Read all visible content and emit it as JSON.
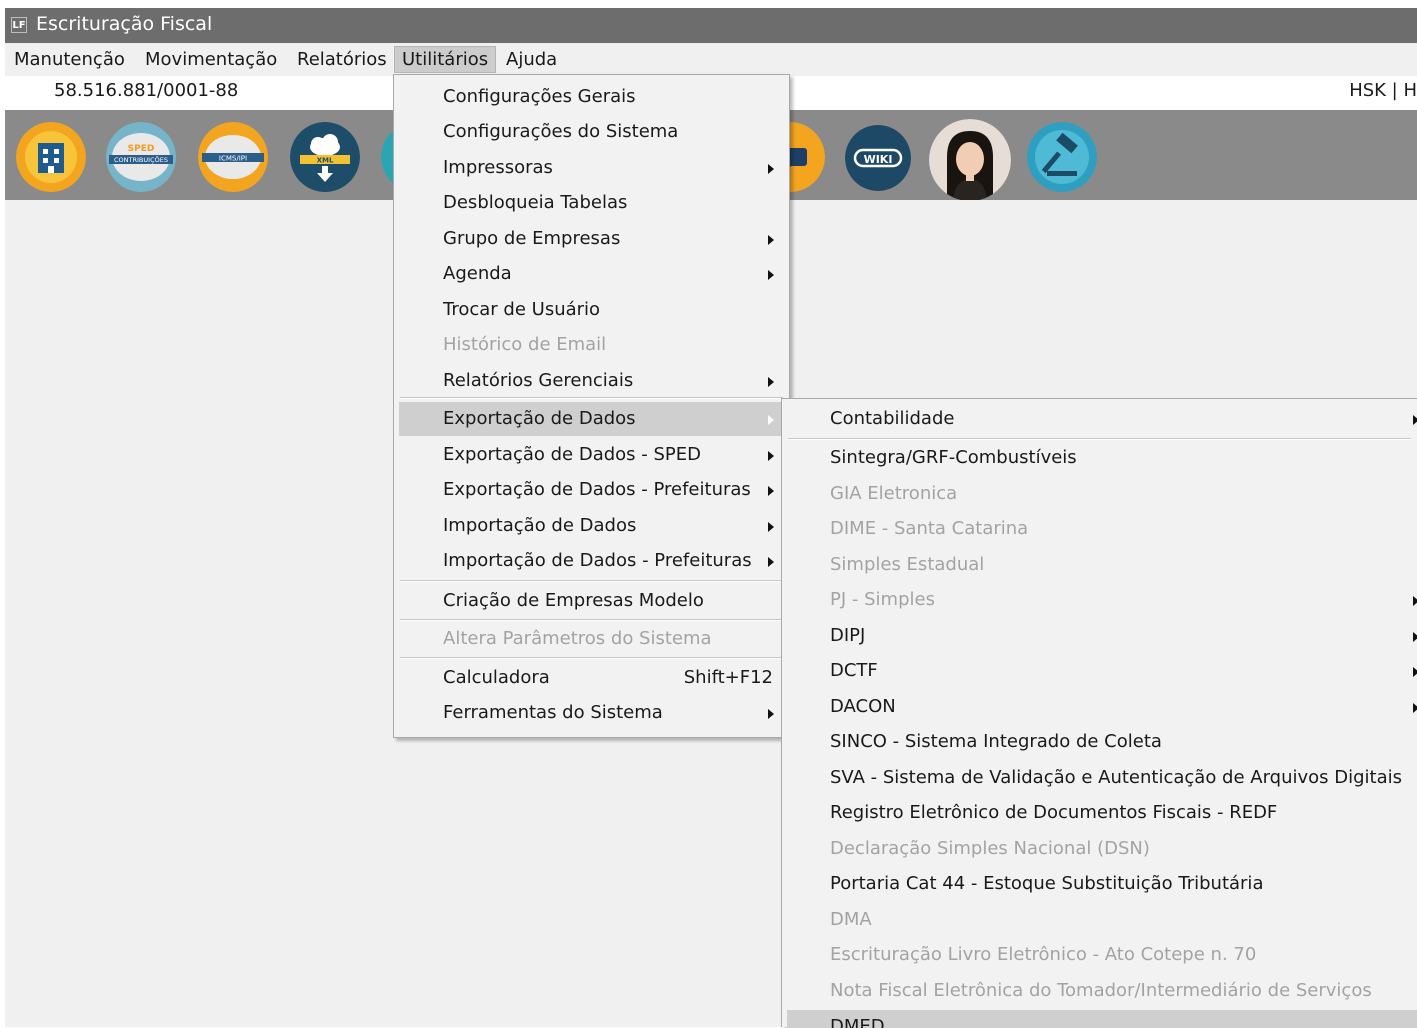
{
  "window": {
    "title": "Escrituração Fiscal",
    "icon_glyph": "LF"
  },
  "menubar": [
    "Manutenção",
    "Movimentação",
    "Relatórios",
    "Utilitários",
    "Ajuda"
  ],
  "info": {
    "cnpj": "58.516.881/0001-88",
    "user": "HSK | H"
  },
  "toolbar": {
    "sped_label_top": "SPED",
    "sped_label_bottom": "CONTRIBUIÇÕES",
    "icms_label": "ICMS/IPI",
    "xml_label": "XML",
    "wiki_label": "WIKI"
  },
  "utilitarios_menu": [
    {
      "label": "Configurações Gerais"
    },
    {
      "label": "Configurações do Sistema"
    },
    {
      "label": "Impressoras",
      "submenu": true
    },
    {
      "label": "Desbloqueia Tabelas"
    },
    {
      "label": "Grupo de Empresas",
      "submenu": true
    },
    {
      "label": "Agenda",
      "submenu": true
    },
    {
      "label": "Trocar de Usuário"
    },
    {
      "label": "Histórico de Email",
      "disabled": true
    },
    {
      "label": "Relatórios Gerenciais",
      "submenu": true
    },
    {
      "label": "Exportação de Dados",
      "submenu": true,
      "highlighted": true
    },
    {
      "label": "Exportação de Dados - SPED",
      "submenu": true
    },
    {
      "label": "Exportação de Dados - Prefeituras",
      "submenu": true
    },
    {
      "label": "Importação de Dados",
      "submenu": true
    },
    {
      "label": "Importação de Dados - Prefeituras",
      "submenu": true
    },
    {
      "label": "Criação de Empresas Modelo"
    },
    {
      "label": "Altera Parâmetros do Sistema",
      "disabled": true
    },
    {
      "label": "Calculadora",
      "shortcut": "Shift+F12"
    },
    {
      "label": "Ferramentas do Sistema",
      "submenu": true
    }
  ],
  "exportacao_submenu": [
    {
      "label": "Contabilidade",
      "submenu": true
    },
    {
      "label": "Sintegra/GRF-Combustíveis"
    },
    {
      "label": "GIA Eletronica",
      "disabled": true
    },
    {
      "label": "DIME - Santa Catarina",
      "disabled": true
    },
    {
      "label": "Simples Estadual",
      "disabled": true
    },
    {
      "label": "PJ - Simples",
      "disabled": true,
      "submenu": true
    },
    {
      "label": "DIPJ",
      "submenu": true
    },
    {
      "label": "DCTF",
      "submenu": true
    },
    {
      "label": "DACON",
      "submenu": true
    },
    {
      "label": "SINCO - Sistema Integrado de Coleta"
    },
    {
      "label": "SVA - Sistema de Validação e Autenticação de Arquivos Digitais"
    },
    {
      "label": "Registro Eletrônico de Documentos Fiscais - REDF"
    },
    {
      "label": "Declaração Simples Nacional (DSN)",
      "disabled": true
    },
    {
      "label": "Portaria Cat 44 - Estoque Substituição Tributária"
    },
    {
      "label": "DMA",
      "disabled": true
    },
    {
      "label": "Escrituração Livro Eletrônico - Ato Cotepe n. 70",
      "disabled": true
    },
    {
      "label": "Nota Fiscal Eletrônica do Tomador/Intermediário de Serviços",
      "disabled": true
    },
    {
      "label": "DMED",
      "highlighted": true
    }
  ],
  "colors": {
    "titlebar": "#6d6d6d",
    "toolbar": "#8a8a8a",
    "menu_bg": "#f2f2f2",
    "highlight": "#cfcfcf",
    "disabled_text": "#a3a3a3"
  }
}
